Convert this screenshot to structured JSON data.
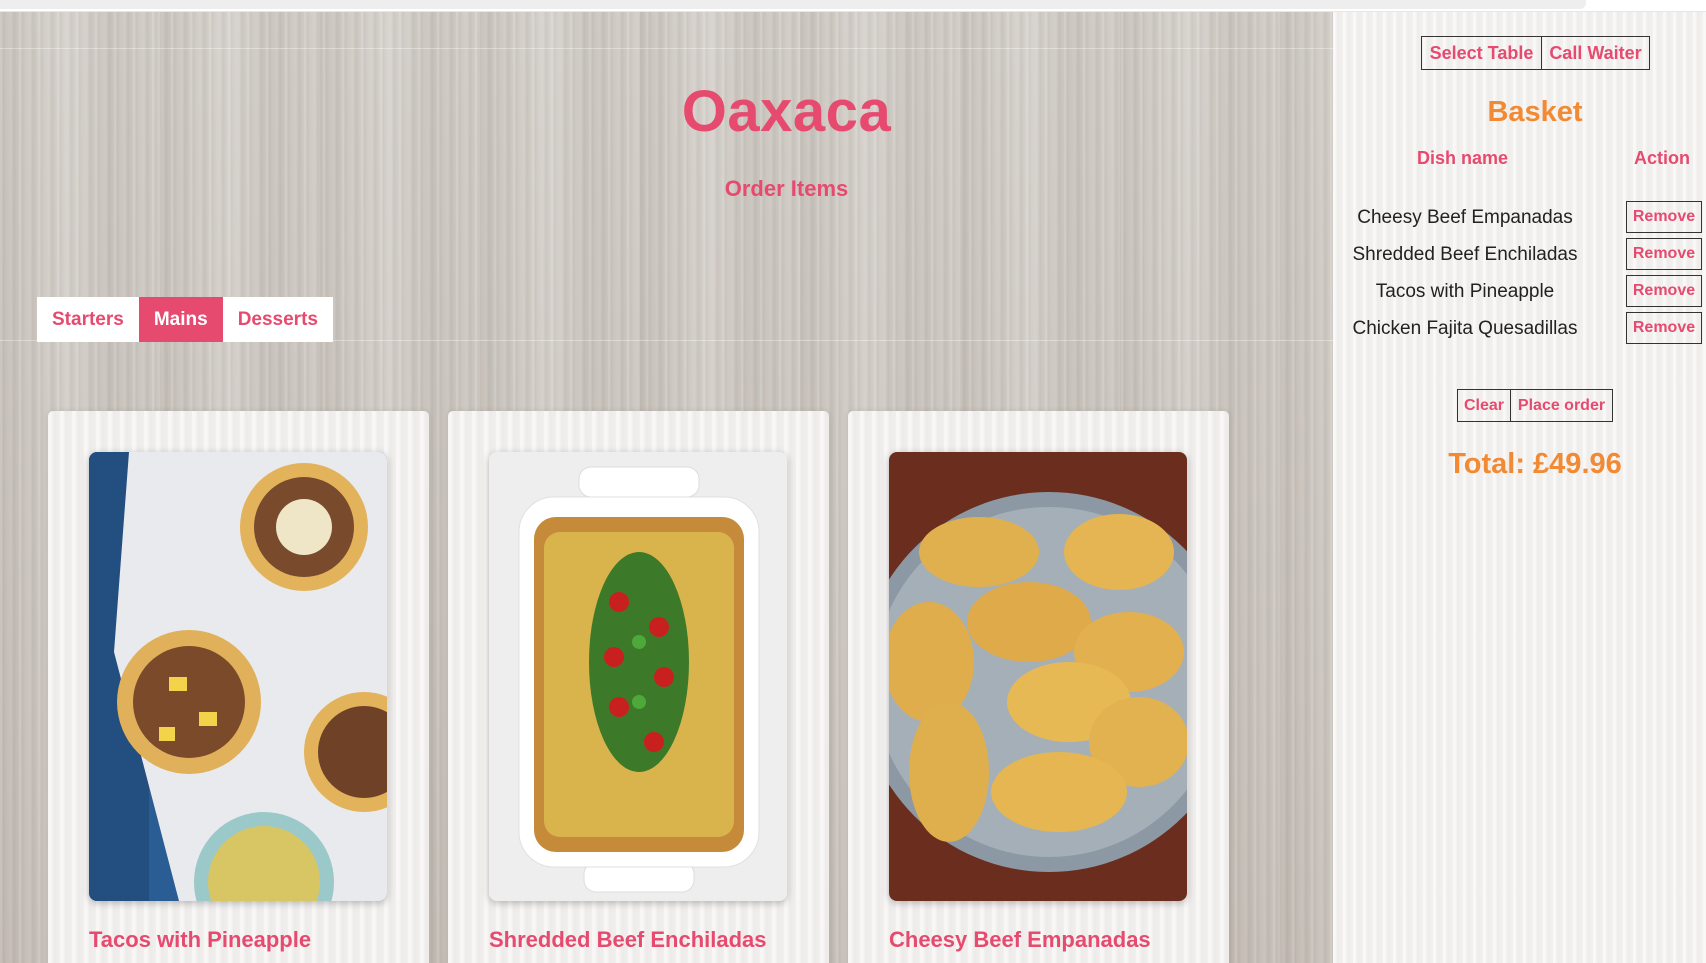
{
  "app": {
    "title": "Oaxaca",
    "subtitle": "Order Items"
  },
  "tabs": [
    {
      "label": "Starters",
      "active": false
    },
    {
      "label": "Mains",
      "active": true
    },
    {
      "label": "Desserts",
      "active": false
    }
  ],
  "menu_items": [
    {
      "name": "Tacos with Pineapple"
    },
    {
      "name": "Shredded Beef Enchiladas"
    },
    {
      "name": "Cheesy Beef Empanadas"
    }
  ],
  "sidebar": {
    "select_table_label": "Select Table",
    "call_waiter_label": "Call Waiter",
    "basket_title": "Basket",
    "col_dish": "Dish name",
    "col_action": "Action",
    "items": [
      {
        "name": "Cheesy Beef Empanadas",
        "action": "Remove"
      },
      {
        "name": "Shredded Beef Enchiladas",
        "action": "Remove"
      },
      {
        "name": "Tacos with Pineapple",
        "action": "Remove"
      },
      {
        "name": "Chicken Fajita Quesadillas",
        "action": "Remove"
      }
    ],
    "clear_label": "Clear",
    "place_order_label": "Place order",
    "total": "Total: £49.96"
  },
  "colors": {
    "brand_pink": "#e64a6f",
    "accent_orange": "#f28a33"
  }
}
